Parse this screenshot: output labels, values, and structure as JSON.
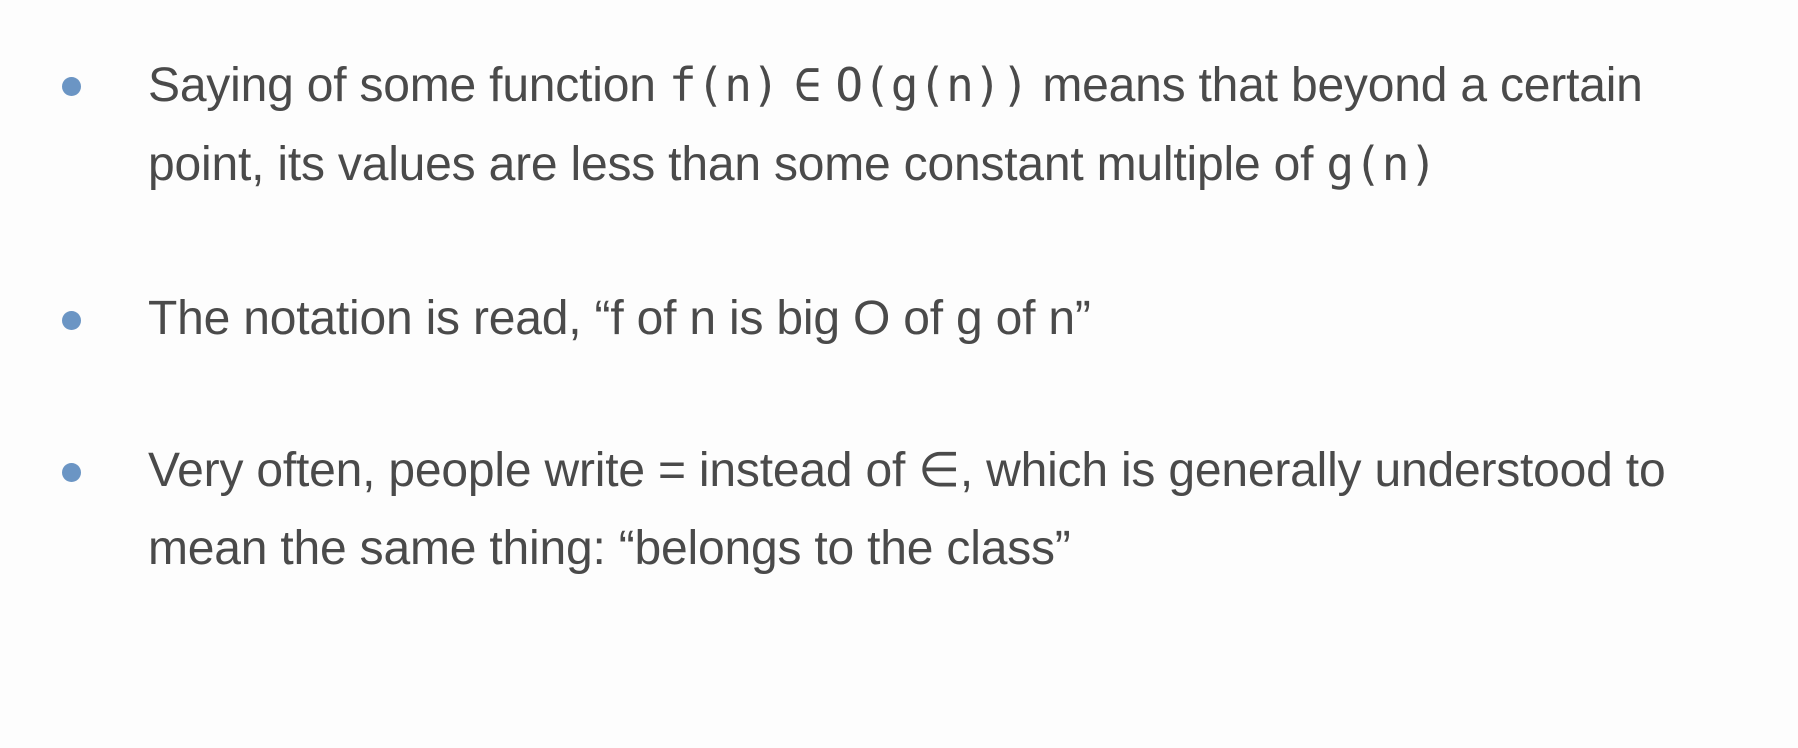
{
  "colors": {
    "bullet": "#6b95c4",
    "text": "#4a4a4a",
    "background": "#fdfdfd"
  },
  "bullets": [
    {
      "segments": [
        "Saying of some function ",
        "f(n)",
        "∈",
        "O(g(n))",
        " means that beyond a certain point, its values are less than some constant multiple of ",
        "g(n)"
      ]
    },
    {
      "text": "The notation is read, “f of n is big O of g of n”"
    },
    {
      "text": "Very often, people write = instead of ∈, which is generally understood to mean the same thing: “belongs to the class”"
    }
  ]
}
